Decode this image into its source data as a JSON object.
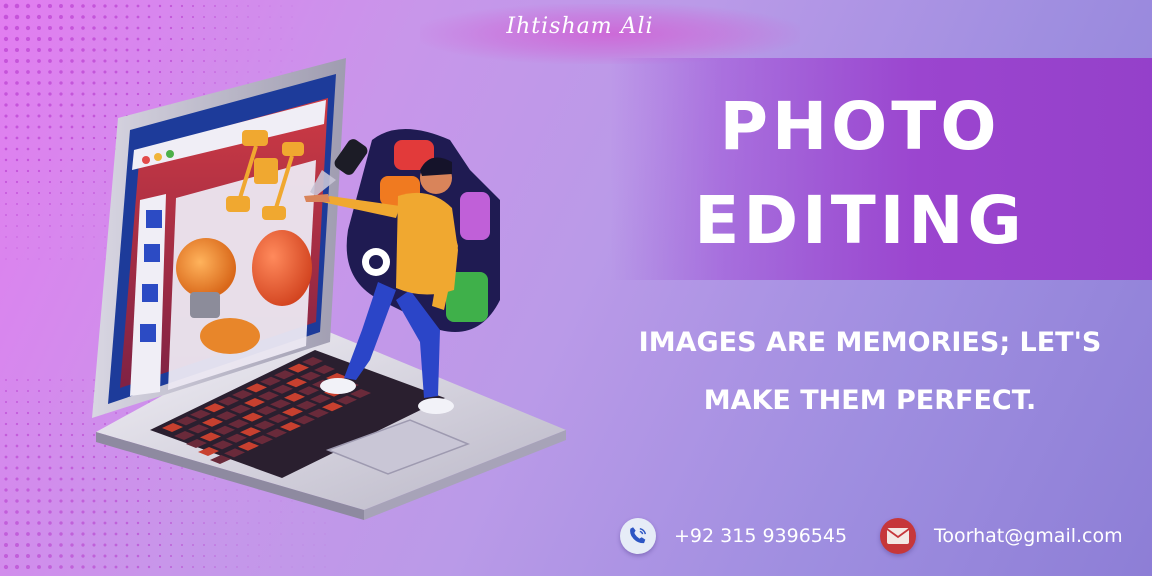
{
  "brand": {
    "name": "Ihtisham Ali"
  },
  "headline": {
    "line1": "PHOTO",
    "line2": "EDITING"
  },
  "tagline": {
    "line1": "IMAGES ARE MEMORIES; LET'S",
    "line2": "MAKE THEM PERFECT."
  },
  "contact": {
    "phone": "+92 315 9396545",
    "email": "Toorhat@gmail.com"
  },
  "icons": {
    "phone": "phone-icon",
    "email": "mail-icon"
  },
  "colors": {
    "band": "#9b45cf",
    "text": "#ffffff",
    "email_icon": "#c6373a",
    "phone_icon": "#e6ecf7"
  }
}
